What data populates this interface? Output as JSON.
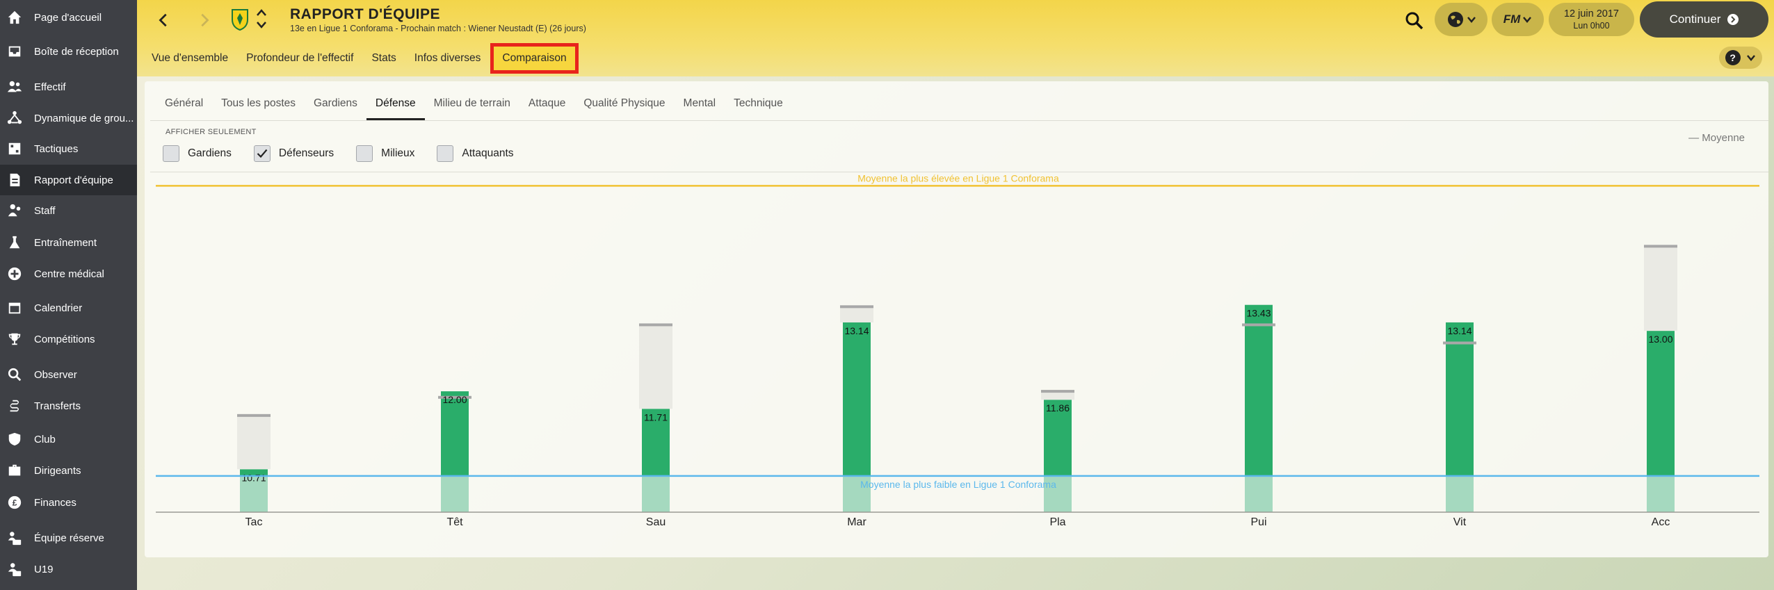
{
  "sidebar": {
    "items": [
      {
        "label": "Page d'accueil",
        "icon": "home-icon",
        "active": false
      },
      {
        "label": "Boîte de réception",
        "icon": "inbox-icon",
        "active": false
      },
      {
        "label": "Effectif",
        "icon": "squad-icon",
        "active": false
      },
      {
        "label": "Dynamique de grou...",
        "icon": "dynamics-icon",
        "active": false
      },
      {
        "label": "Tactiques",
        "icon": "tactics-icon",
        "active": false
      },
      {
        "label": "Rapport d'équipe",
        "icon": "report-icon",
        "active": true
      },
      {
        "label": "Staff",
        "icon": "staff-icon",
        "active": false
      },
      {
        "label": "Entraînement",
        "icon": "training-icon",
        "active": false
      },
      {
        "label": "Centre médical",
        "icon": "medical-icon",
        "active": false
      },
      {
        "label": "Calendrier",
        "icon": "calendar-icon",
        "active": false
      },
      {
        "label": "Compétitions",
        "icon": "trophy-icon",
        "active": false
      },
      {
        "label": "Observer",
        "icon": "search-icon",
        "active": false
      },
      {
        "label": "Transferts",
        "icon": "transfers-icon",
        "active": false
      },
      {
        "label": "Club",
        "icon": "club-shield-icon",
        "active": false
      },
      {
        "label": "Dirigeants",
        "icon": "briefcase-icon",
        "active": false
      },
      {
        "label": "Finances",
        "icon": "finances-icon",
        "active": false
      },
      {
        "label": "Équipe réserve",
        "icon": "reserve-icon",
        "active": false
      },
      {
        "label": "U19",
        "icon": "u19-icon",
        "active": false
      }
    ]
  },
  "header": {
    "title": "RAPPORT D'ÉQUIPE",
    "subtitle": "13e en Ligue 1 Conforama - Prochain match : Wiener Neustadt (E) (26 jours)",
    "date": "12 juin 2017",
    "time": "Lun 0h00",
    "continue_label": "Continuer",
    "fm_label": "FM",
    "help_label": "?"
  },
  "main_tabs": [
    {
      "label": "Vue d'ensemble"
    },
    {
      "label": "Profondeur de l'effectif"
    },
    {
      "label": "Stats"
    },
    {
      "label": "Infos diverses"
    },
    {
      "label": "Comparaison",
      "highlighted": true
    }
  ],
  "sub_tabs": [
    {
      "label": "Général"
    },
    {
      "label": "Tous les postes"
    },
    {
      "label": "Gardiens"
    },
    {
      "label": "Défense",
      "active": true
    },
    {
      "label": "Milieu de terrain"
    },
    {
      "label": "Attaque"
    },
    {
      "label": "Qualité Physique"
    },
    {
      "label": "Mental"
    },
    {
      "label": "Technique"
    }
  ],
  "filters": {
    "title": "AFFICHER SEULEMENT",
    "items": [
      {
        "label": "Gardiens",
        "checked": false
      },
      {
        "label": "Défenseurs",
        "checked": true
      },
      {
        "label": "Milieux",
        "checked": false
      },
      {
        "label": "Attaquants",
        "checked": false
      }
    ],
    "legend": "— Moyenne"
  },
  "colors": {
    "bar": "#2aad6a",
    "bar_below": "#a5d9bf",
    "highest_line": "#f1c232",
    "lowest_line": "#5bb8ec",
    "average_tick": "#a8a8a8",
    "highlight_box": "#e8241c"
  },
  "chart_data": {
    "type": "bar",
    "categories": [
      "Tac",
      "Têt",
      "Sau",
      "Mar",
      "Pla",
      "Pui",
      "Vit",
      "Acc"
    ],
    "values": [
      10.71,
      12.0,
      11.71,
      13.14,
      11.86,
      13.43,
      13.14,
      13.0
    ],
    "value_labels": [
      "10.71",
      "12.00",
      "11.71",
      "13.14",
      "11.86",
      "13.43",
      "13.14",
      "13.00"
    ],
    "average": [
      11.6,
      11.9,
      13.1,
      13.4,
      12.0,
      13.1,
      12.8,
      14.4
    ],
    "reference_lines": {
      "highest": {
        "label": "Moyenne la plus élevée en Ligue 1 Conforama",
        "value": 15.4
      },
      "lowest": {
        "label": "Moyenne la plus faible en Ligue 1 Conforama",
        "value": 10.6
      }
    },
    "ylim": [
      10.0,
      15.6
    ],
    "legend": "Moyenne"
  }
}
